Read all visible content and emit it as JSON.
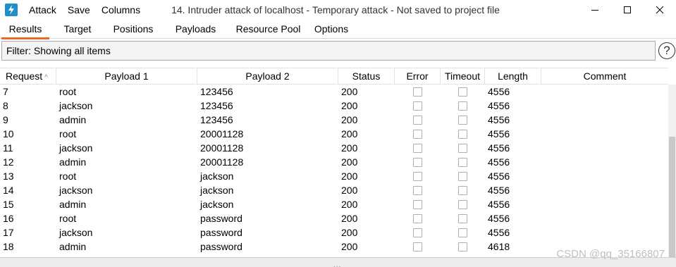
{
  "titlebar": {
    "menu": [
      "Attack",
      "Save",
      "Columns"
    ],
    "title": "14. Intruder attack of localhost - Temporary attack - Not saved to project file"
  },
  "tabs": [
    "Results",
    "Target",
    "Positions",
    "Payloads",
    "Resource Pool",
    "Options"
  ],
  "filter": {
    "label": "Filter: Showing all items"
  },
  "table": {
    "columns": [
      "Request",
      "Payload 1",
      "Payload 2",
      "Status",
      "Error",
      "Timeout",
      "Length",
      "Comment"
    ],
    "rows": [
      {
        "request": "7",
        "payload1": "root",
        "payload2": "123456",
        "status": "200",
        "length": "4556"
      },
      {
        "request": "8",
        "payload1": "jackson",
        "payload2": "123456",
        "status": "200",
        "length": "4556"
      },
      {
        "request": "9",
        "payload1": "admin",
        "payload2": "123456",
        "status": "200",
        "length": "4556"
      },
      {
        "request": "10",
        "payload1": "root",
        "payload2": "20001128",
        "status": "200",
        "length": "4556"
      },
      {
        "request": "11",
        "payload1": "jackson",
        "payload2": "20001128",
        "status": "200",
        "length": "4556"
      },
      {
        "request": "12",
        "payload1": "admin",
        "payload2": "20001128",
        "status": "200",
        "length": "4556"
      },
      {
        "request": "13",
        "payload1": "root",
        "payload2": "jackson",
        "status": "200",
        "length": "4556"
      },
      {
        "request": "14",
        "payload1": "jackson",
        "payload2": "jackson",
        "status": "200",
        "length": "4556"
      },
      {
        "request": "15",
        "payload1": "admin",
        "payload2": "jackson",
        "status": "200",
        "length": "4556"
      },
      {
        "request": "16",
        "payload1": "root",
        "payload2": "password",
        "status": "200",
        "length": "4556"
      },
      {
        "request": "17",
        "payload1": "jackson",
        "payload2": "password",
        "status": "200",
        "length": "4556"
      },
      {
        "request": "18",
        "payload1": "admin",
        "payload2": "password",
        "status": "200",
        "length": "4618"
      }
    ]
  },
  "watermark": "CSDN @qq_35166807",
  "colors": {
    "accent": "#e8692a",
    "app_icon": "#1f8fc9"
  },
  "icons": [
    "burp-app-icon",
    "minimize-icon",
    "maximize-icon",
    "close-icon",
    "help-icon",
    "sort-ascending-icon"
  ]
}
